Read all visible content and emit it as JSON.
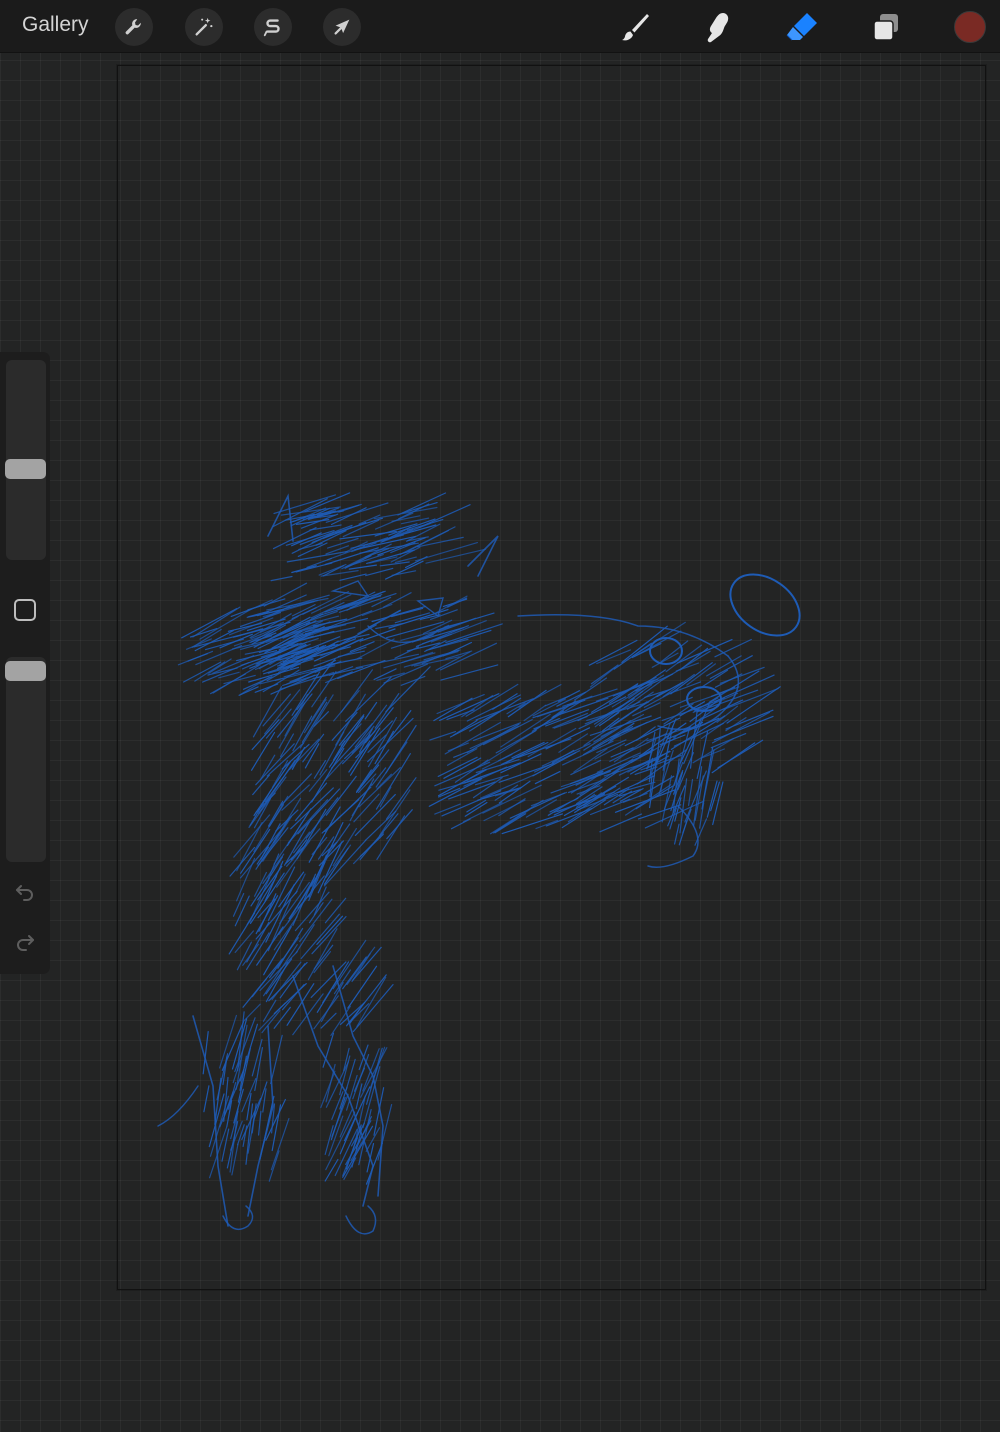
{
  "app": {
    "gallery_label": "Gallery"
  },
  "toolbar": {
    "left_tools": [
      {
        "name": "actions",
        "icon": "wrench-icon"
      },
      {
        "name": "adjustments",
        "icon": "magic-wand-icon"
      },
      {
        "name": "selection",
        "icon": "selection-s-icon"
      },
      {
        "name": "transform",
        "icon": "arrow-cursor-icon"
      }
    ],
    "right_tools": [
      {
        "name": "brush",
        "icon": "brush-icon",
        "active": false
      },
      {
        "name": "smudge",
        "icon": "smudge-finger-icon",
        "active": false
      },
      {
        "name": "eraser",
        "icon": "eraser-icon",
        "active": true
      },
      {
        "name": "layers",
        "icon": "layers-icon",
        "active": false
      }
    ],
    "active_color": "#7a2a24",
    "accent_color": "#1a82ff"
  },
  "sidebar": {
    "brush_size_level": 0.45,
    "brush_opacity_level": 0.98,
    "modify_icon": "square-icon",
    "undo_icon": "undo-icon",
    "redo_icon": "redo-icon"
  },
  "canvas": {
    "stroke_color": "#1e5bb5",
    "background_color": "#232424"
  }
}
